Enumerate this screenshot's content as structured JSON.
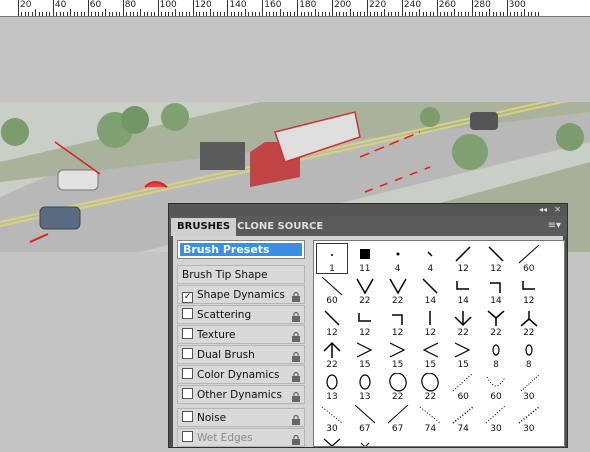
{
  "ruler": {
    "labels": [
      "20",
      "40",
      "60",
      "80",
      "100",
      "120",
      "140",
      "160",
      "180",
      "200",
      "220",
      "240",
      "260",
      "280",
      "300"
    ]
  },
  "panel": {
    "tabs": [
      {
        "label": "BRUSHES",
        "active": true
      },
      {
        "label": "CLONE SOURCE",
        "active": false
      }
    ],
    "controls": {
      "collapse": "◂◂",
      "close": "✕",
      "menu": "≡▾"
    },
    "presets_label": "Brush Presets",
    "tip_shape_label": "Brush Tip Shape",
    "options": [
      {
        "label": "Shape Dynamics",
        "checked": true,
        "lock": true
      },
      {
        "label": "Scattering",
        "checked": false,
        "lock": true
      },
      {
        "label": "Texture",
        "checked": false,
        "lock": true
      },
      {
        "label": "Dual Brush",
        "checked": false,
        "lock": true
      },
      {
        "label": "Color Dynamics",
        "checked": false,
        "lock": true
      },
      {
        "label": "Other Dynamics",
        "checked": false,
        "lock": true
      },
      {
        "label": "Noise",
        "checked": false,
        "lock": true
      },
      {
        "label": "Wet Edges",
        "checked": false,
        "lock": true,
        "disabled": true
      }
    ],
    "brushes": [
      {
        "size": "1",
        "shape": "dot-small",
        "selected": true
      },
      {
        "size": "11",
        "shape": "square"
      },
      {
        "size": "4",
        "shape": "dot"
      },
      {
        "size": "4",
        "shape": "diag-short"
      },
      {
        "size": "12",
        "shape": "line-ne"
      },
      {
        "size": "12",
        "shape": "line-nw"
      },
      {
        "size": "60",
        "shape": "line-ne-long"
      },
      {
        "size": "60",
        "shape": "line-nw-long"
      },
      {
        "size": "22",
        "shape": "v-shape"
      },
      {
        "size": "22",
        "shape": "v-shape"
      },
      {
        "size": "14",
        "shape": "line-nw"
      },
      {
        "size": "14",
        "shape": "corner"
      },
      {
        "size": "14",
        "shape": "corner-r"
      },
      {
        "size": "12",
        "shape": "corner"
      },
      {
        "size": "12",
        "shape": "line-nw"
      },
      {
        "size": "12",
        "shape": "corner"
      },
      {
        "size": "12",
        "shape": "corner-r"
      },
      {
        "size": "12",
        "shape": "line-vert"
      },
      {
        "size": "22",
        "shape": "arrow-down"
      },
      {
        "size": "22",
        "shape": "y-shape"
      },
      {
        "size": "22",
        "shape": "y-inv"
      },
      {
        "size": "22",
        "shape": "arrow-up"
      },
      {
        "size": "15",
        "shape": "chevron-r"
      },
      {
        "size": "15",
        "shape": "chevron-r"
      },
      {
        "size": "15",
        "shape": "chevron-l"
      },
      {
        "size": "15",
        "shape": "chevron-r"
      },
      {
        "size": "8",
        "shape": "oval-small"
      },
      {
        "size": "8",
        "shape": "oval-small"
      },
      {
        "size": "13",
        "shape": "oval"
      },
      {
        "size": "13",
        "shape": "oval"
      },
      {
        "size": "22",
        "shape": "oval-large"
      },
      {
        "size": "22",
        "shape": "oval-large"
      },
      {
        "size": "60",
        "shape": "dots-diag"
      },
      {
        "size": "60",
        "shape": "dots-arc"
      },
      {
        "size": "30",
        "shape": "dots-diag-r"
      },
      {
        "size": "30",
        "shape": "dots-nw"
      },
      {
        "size": "67",
        "shape": "line-nw-long"
      },
      {
        "size": "67",
        "shape": "line-ne-long"
      },
      {
        "size": "74",
        "shape": "dots-nw"
      },
      {
        "size": "74",
        "shape": "dots-ne"
      },
      {
        "size": "30",
        "shape": "dots-diag"
      },
      {
        "size": "30",
        "shape": "dots-ne"
      },
      {
        "size": "",
        "shape": "cross-x"
      },
      {
        "size": "",
        "shape": "x-small"
      }
    ]
  }
}
